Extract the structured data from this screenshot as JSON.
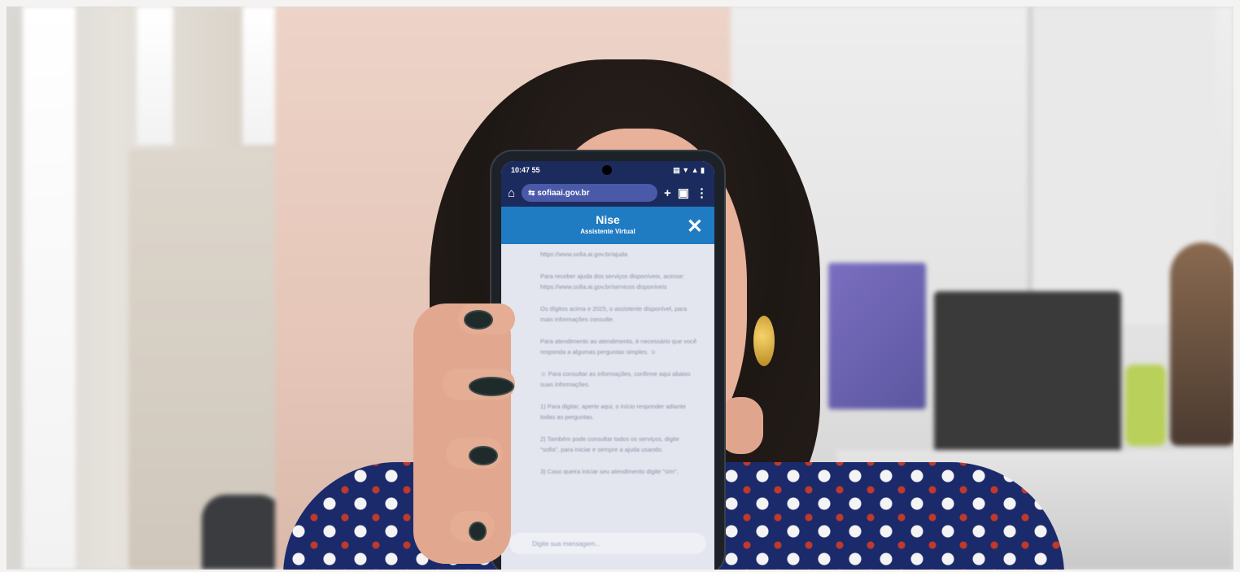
{
  "phone": {
    "status_time": "10:47 55",
    "status_icons": "▤ ▼ ▲ ▮",
    "url": "⇆ sofiaai.gov.br",
    "chat_title": "Nise",
    "chat_subtitle": "Assistente Virtual",
    "close_symbol": "✕",
    "messages": [
      "https://www.sofia.ai.gov.br/ajuda",
      "Para receber ajuda dos serviços disponíveis, acesse: https://www.sofia.ai.gov.br/servicos disponíveis",
      "Os dígitos acima e 2025, o assistente disponível, para mais informações consulte.",
      "Para atendimento ao atendimento, é necessário que você responda a algumas perguntas simples. ☺",
      "☺ Para consultar as informações, confirme aqui abaixo suas informações.",
      "1) Para digitar, aperte aqui, o início responder adiante todas as perguntas.",
      "2) Também pode consultar todos os serviços, digite \"sofia\", para iniciar e sempre a ajuda usando.",
      "3) Caso queira iniciar seu atendimento digite \"sim\"."
    ],
    "input_placeholder": "Digite sua mensagem..."
  }
}
